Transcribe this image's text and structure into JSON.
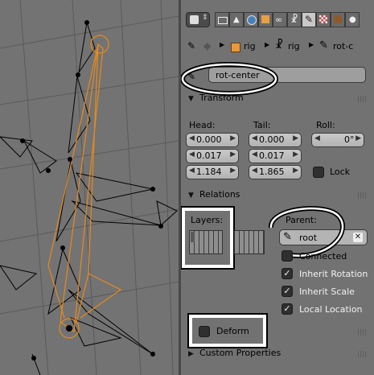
{
  "header": {
    "breadcrumb": [
      {
        "icon": "object-icon",
        "label": "rig"
      },
      {
        "icon": "armature-icon",
        "label": "rig"
      },
      {
        "icon": "bone-icon",
        "label": "rot-c"
      }
    ]
  },
  "bone_name": "rot-center",
  "transform": {
    "title": "Transform",
    "head_label": "Head:",
    "tail_label": "Tail:",
    "roll_label": "Roll:",
    "head": [
      "0.000",
      "0.017",
      "1.184"
    ],
    "tail": [
      "0.000",
      "0.017",
      "1.865"
    ],
    "roll": "0°",
    "lock_label": "Lock"
  },
  "relations": {
    "title": "Relations",
    "layers_label": "Layers:",
    "parent_label": "Parent:",
    "parent_value": "root",
    "connected_label": "Connected",
    "inherit_rotation_label": "Inherit Rotation",
    "inherit_scale_label": "Inherit Scale",
    "local_location_label": "Local Location"
  },
  "deform_label": "Deform",
  "custom_properties_label": "Custom Properties",
  "colors": {
    "selected_bone": "#e88a1a",
    "panel_bg": "#727272",
    "annotation": "#ffffff"
  }
}
